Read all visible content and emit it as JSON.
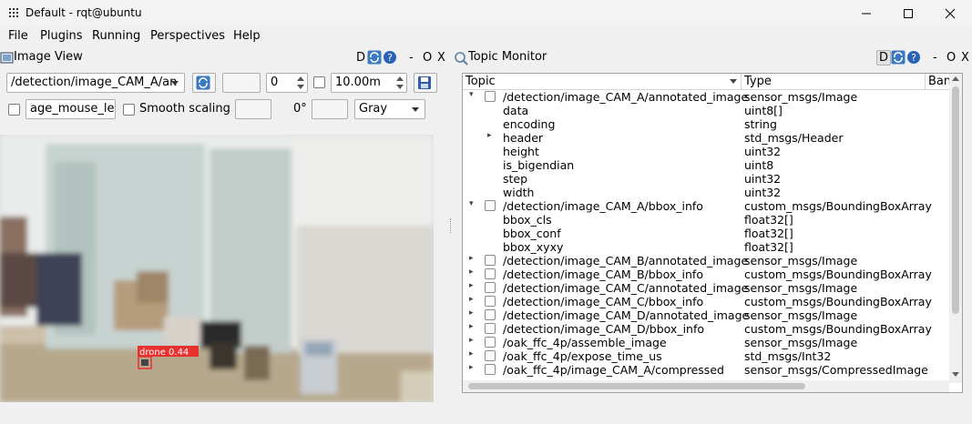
{
  "window": {
    "title": "Default - rqt@ubuntu"
  },
  "menu": [
    "File",
    "Plugins",
    "Running",
    "Perspectives",
    "Help"
  ],
  "image_view": {
    "title": "Image View",
    "header_buttons": {
      "d": "D",
      "dash": "-",
      "o": "O",
      "x": "X"
    },
    "topic_select": "/detection/image_CAM_A/an",
    "spin_value": "0",
    "distance_value": "10.00m",
    "mouse_topic": "age_mouse_left",
    "smooth_label": "Smooth scaling",
    "rotation": "0°",
    "color_mode": "Gray",
    "detection_label": "drone  0.44"
  },
  "topic_monitor": {
    "title": "Topic Monitor",
    "header_buttons": {
      "d": "D",
      "dash": "-",
      "o": "O",
      "x": "X"
    },
    "columns": [
      "Topic",
      "Type",
      "Ban"
    ],
    "rows": [
      {
        "name": "/detection/image_CAM_A/annotated_image",
        "type": "sensor_msgs/Image",
        "level": 0,
        "arrow": "▾"
      },
      {
        "name": "data",
        "type": "uint8[]",
        "level": 1,
        "arrow": ""
      },
      {
        "name": "encoding",
        "type": "string",
        "level": 1,
        "arrow": ""
      },
      {
        "name": "header",
        "type": "std_msgs/Header",
        "level": 1,
        "arrow": "▸"
      },
      {
        "name": "height",
        "type": "uint32",
        "level": 1,
        "arrow": ""
      },
      {
        "name": "is_bigendian",
        "type": "uint8",
        "level": 1,
        "arrow": ""
      },
      {
        "name": "step",
        "type": "uint32",
        "level": 1,
        "arrow": ""
      },
      {
        "name": "width",
        "type": "uint32",
        "level": 1,
        "arrow": ""
      },
      {
        "name": "/detection/image_CAM_A/bbox_info",
        "type": "custom_msgs/BoundingBoxArray",
        "level": 0,
        "arrow": "▾"
      },
      {
        "name": "bbox_cls",
        "type": "float32[]",
        "level": 1,
        "arrow": ""
      },
      {
        "name": "bbox_conf",
        "type": "float32[]",
        "level": 1,
        "arrow": ""
      },
      {
        "name": "bbox_xyxy",
        "type": "float32[]",
        "level": 1,
        "arrow": ""
      },
      {
        "name": "/detection/image_CAM_B/annotated_image",
        "type": "sensor_msgs/Image",
        "level": 0,
        "arrow": "▸"
      },
      {
        "name": "/detection/image_CAM_B/bbox_info",
        "type": "custom_msgs/BoundingBoxArray",
        "level": 0,
        "arrow": "▸"
      },
      {
        "name": "/detection/image_CAM_C/annotated_image",
        "type": "sensor_msgs/Image",
        "level": 0,
        "arrow": "▸"
      },
      {
        "name": "/detection/image_CAM_C/bbox_info",
        "type": "custom_msgs/BoundingBoxArray",
        "level": 0,
        "arrow": "▸"
      },
      {
        "name": "/detection/image_CAM_D/annotated_image",
        "type": "sensor_msgs/Image",
        "level": 0,
        "arrow": "▸"
      },
      {
        "name": "/detection/image_CAM_D/bbox_info",
        "type": "custom_msgs/BoundingBoxArray",
        "level": 0,
        "arrow": "▸"
      },
      {
        "name": "/oak_ffc_4p/assemble_image",
        "type": "sensor_msgs/Image",
        "level": 0,
        "arrow": "▸"
      },
      {
        "name": "/oak_ffc_4p/expose_time_us",
        "type": "std_msgs/Int32",
        "level": 0,
        "arrow": "▸"
      },
      {
        "name": "/oak_ffc_4p/image_CAM_A/compressed",
        "type": "sensor_msgs/CompressedImage",
        "level": 0,
        "arrow": "▸"
      }
    ]
  }
}
